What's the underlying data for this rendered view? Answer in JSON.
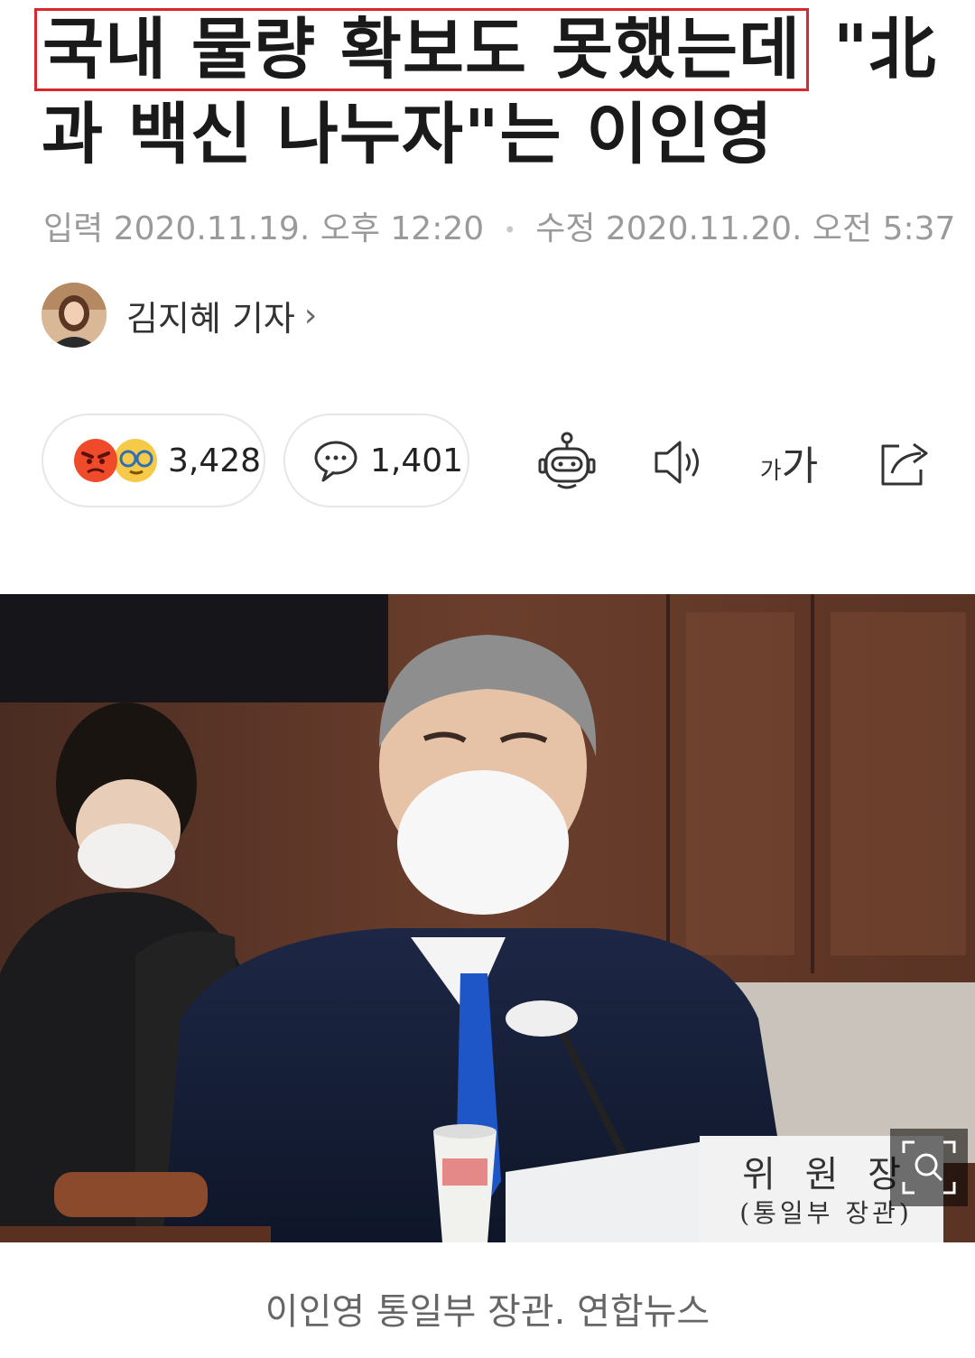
{
  "article": {
    "headline_highlight": "국내 물량 확보도 못했는데",
    "headline_line1_rest": " \"北",
    "headline_line2": "과 백신 나누자\"는 이인영",
    "meta": {
      "input_label": "입력",
      "input_time": "2020.11.19. 오후 12:20",
      "modified_label": "수정",
      "modified_time": "2020.11.20. 오전 5:37"
    },
    "author": {
      "name": "김지혜 기자",
      "chevron": "›"
    },
    "reactions": {
      "count": "3,428",
      "icons": [
        "angry-face-icon",
        "glasses-face-icon"
      ]
    },
    "comments": {
      "count": "1,401",
      "icon": "speech-bubble-icon"
    },
    "toolbar": {
      "bot_icon": "robot-icon",
      "speaker_icon": "speaker-icon",
      "font_size_label_small": "가",
      "font_size_label_large": "가",
      "share_icon": "share-icon"
    },
    "photo": {
      "nameplate_text": "위 원 장",
      "nameplate_sub": "(통일부 장관)"
    },
    "caption": "이인영 통일부 장관. 연합뉴스"
  },
  "colors": {
    "highlight_border": "#d9262f",
    "meta_text": "#9a9a9a",
    "angry_face": "#ef4b2b",
    "glasses_face": "#f7c948"
  }
}
